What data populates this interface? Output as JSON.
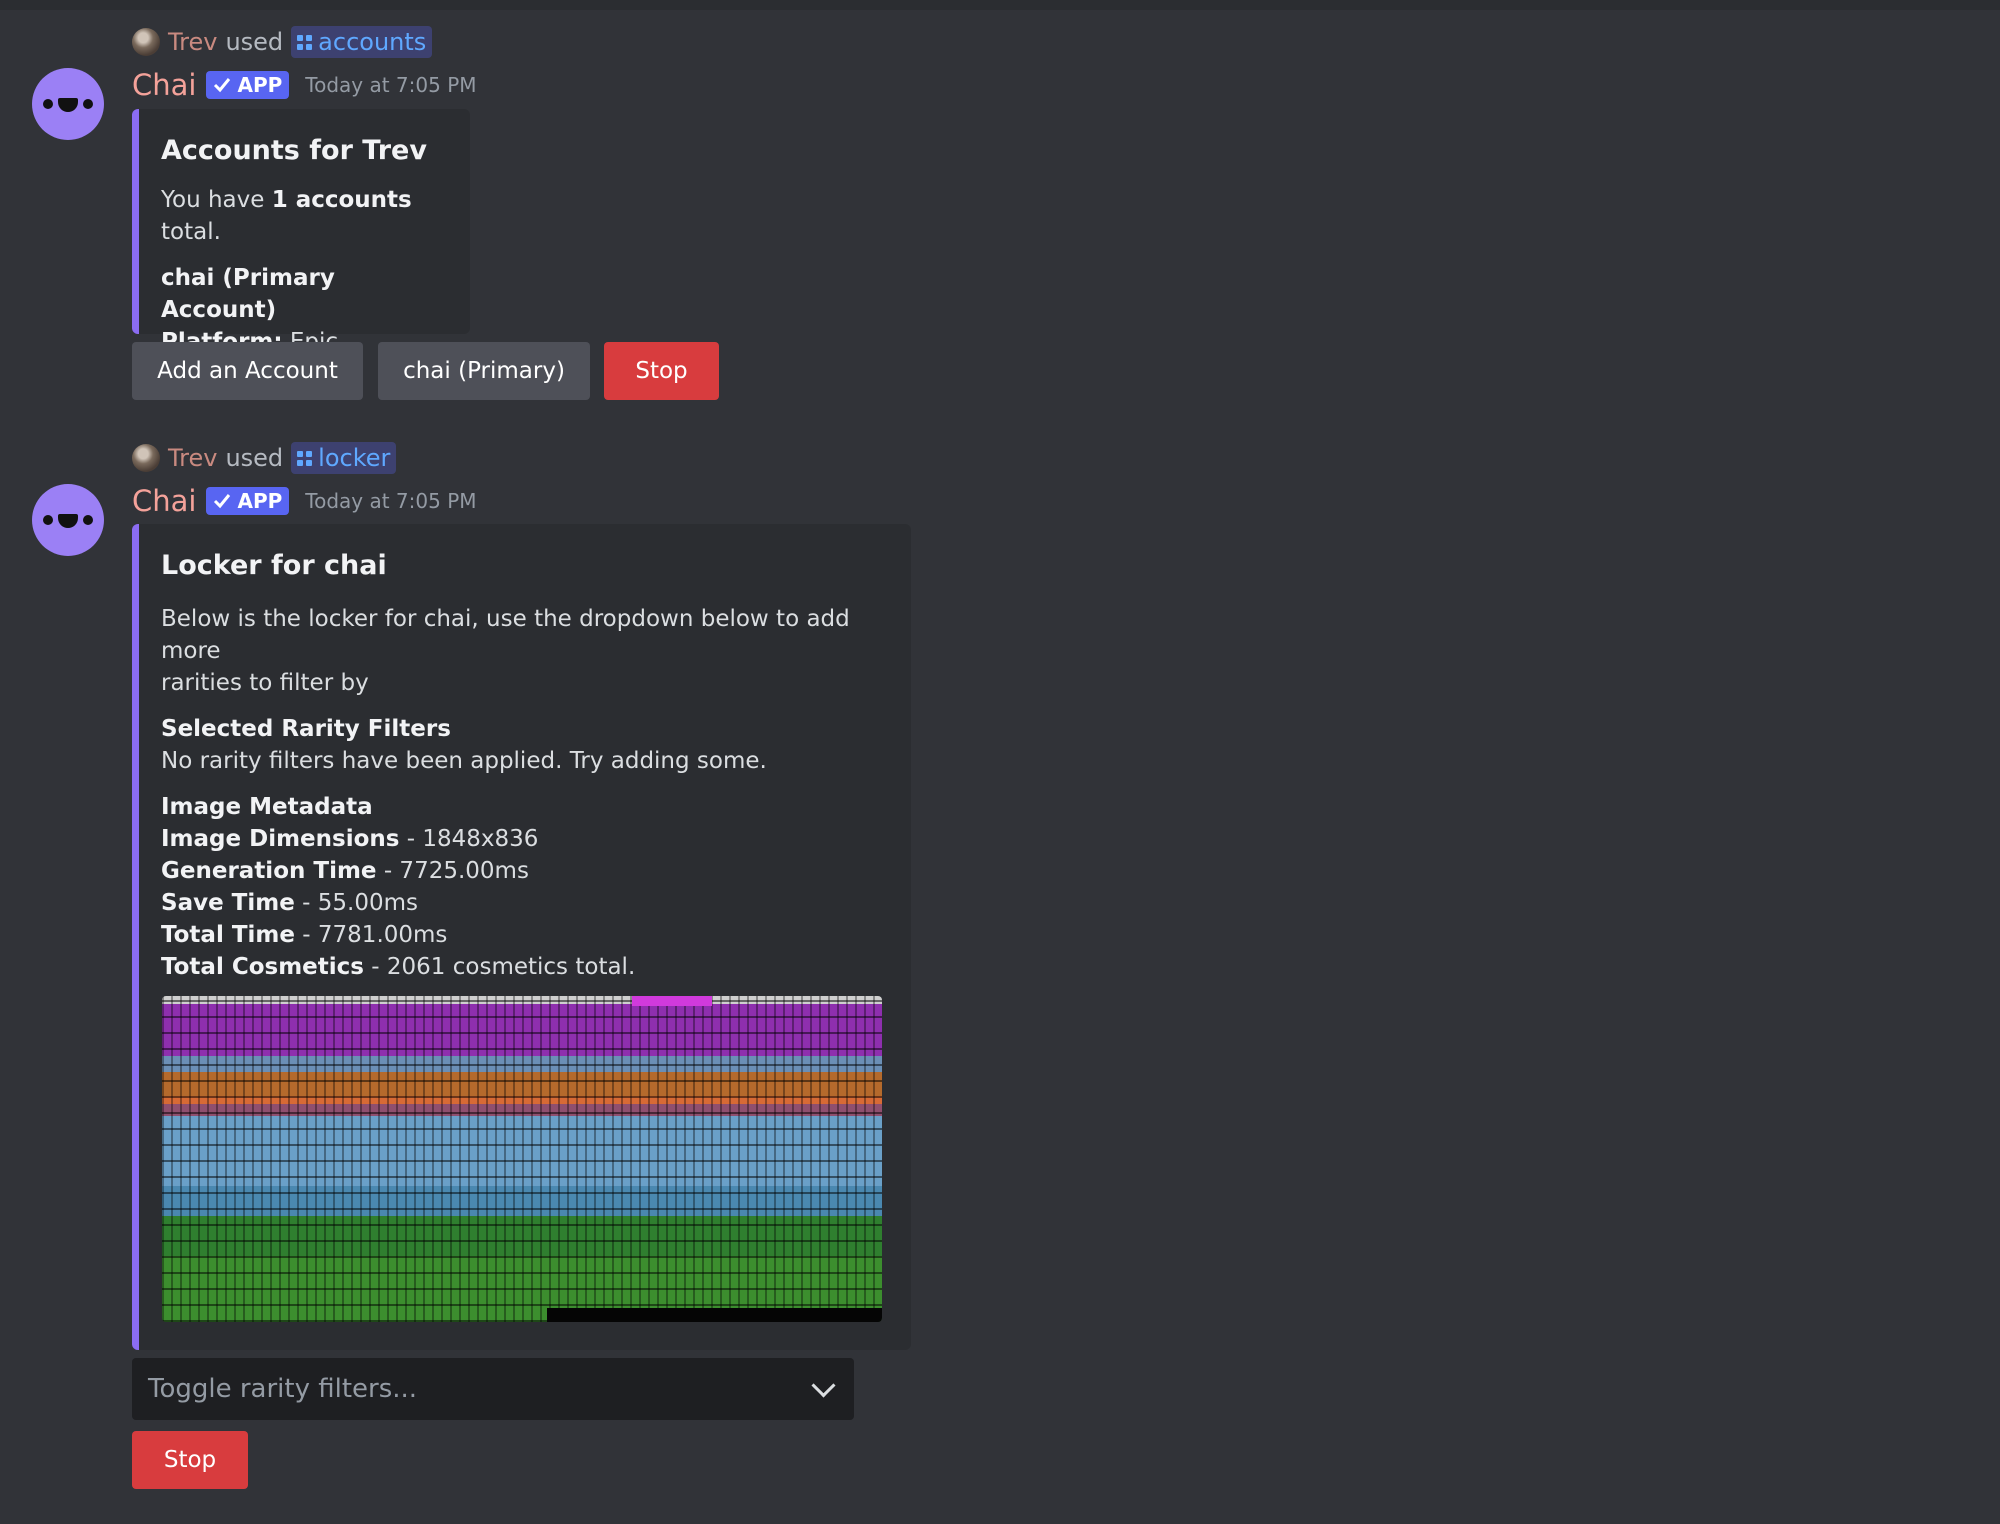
{
  "messages": [
    {
      "invoker": "Trev",
      "used_text": "used",
      "command": "accounts",
      "bot_name": "Chai",
      "badge": "APP",
      "timestamp": "Today at 7:05 PM",
      "embed": {
        "title": "Accounts for Trev",
        "summary_prefix": "You have ",
        "summary_bold": "1 accounts",
        "summary_suffix": " total.",
        "account_name": "chai (Primary Account)",
        "platform_label": "Platform:",
        "platform_value": " Epic"
      },
      "buttons": [
        "Add an Account",
        "chai (Primary)",
        "Stop"
      ]
    },
    {
      "invoker": "Trev",
      "used_text": "used",
      "command": "locker",
      "bot_name": "Chai",
      "badge": "APP",
      "timestamp": "Today at 7:05 PM",
      "embed": {
        "title": "Locker for chai",
        "description_line1": "Below is the locker for chai, use the dropdown below to add more",
        "description_line2": "rarities to filter by",
        "filters_heading": "Selected Rarity Filters",
        "filters_text": "No rarity filters have been applied. Try adding some.",
        "metadata_heading": "Image Metadata",
        "metadata": [
          {
            "label": "Image Dimensions",
            "value": " - 1848x836"
          },
          {
            "label": "Generation Time",
            "value": " - 7725.00ms"
          },
          {
            "label": "Save Time",
            "value": " - 55.00ms"
          },
          {
            "label": "Total Time",
            "value": " - 7781.00ms"
          },
          {
            "label": "Total Cosmetics",
            "value": " - 2061 cosmetics total."
          }
        ]
      },
      "select_placeholder": "Toggle rarity filters...",
      "buttons": [
        "Stop"
      ]
    }
  ],
  "colors": {
    "background": "#313338",
    "embed_bg": "#2b2d31",
    "embed_accent": "#8b6cf2",
    "danger": "#d83c3e",
    "secondary": "#4e5058",
    "blurple": "#5865f2",
    "bot_name": "#f4a29a"
  },
  "icons": [
    "user-avatar-icon",
    "slash-command-icon",
    "bot-avatar-icon",
    "verified-check-icon",
    "chevron-down-icon"
  ]
}
